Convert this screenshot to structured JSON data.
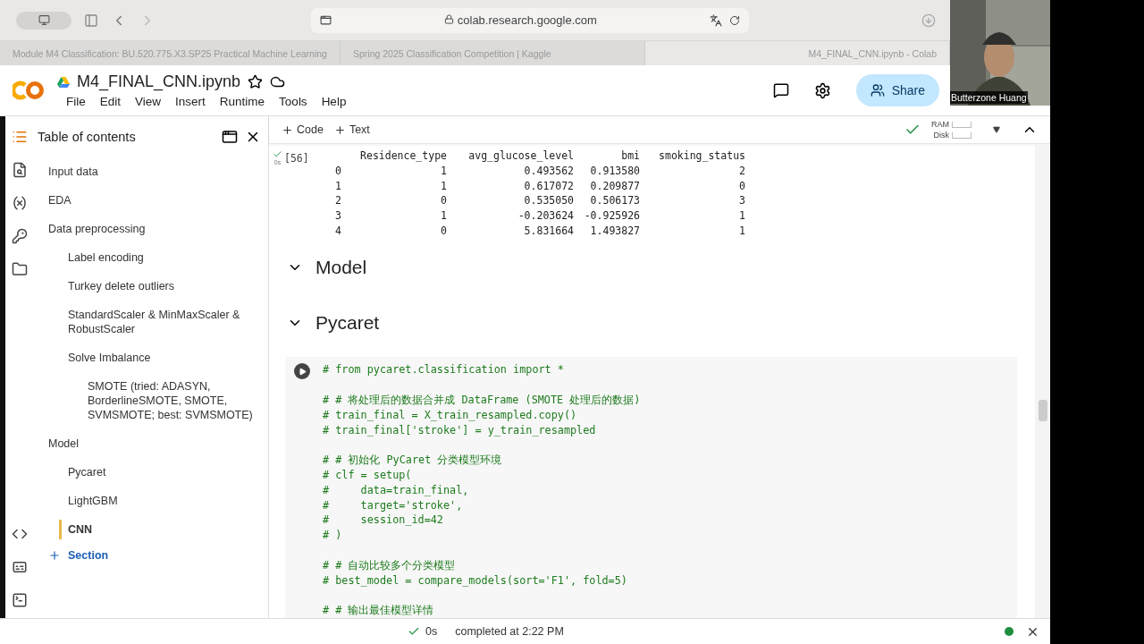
{
  "browser": {
    "url": "colab.research.google.com",
    "tabs": [
      {
        "title": "Module M4 Classification: BU.520.775.X3.SP25 Practical Machine Learning",
        "selected": false
      },
      {
        "title": "Spring 2025 Classification Competition | Kaggle",
        "selected": false
      },
      {
        "title": "M4_FINAL_CNN.ipynb - Colab",
        "selected": true
      }
    ]
  },
  "notebook": {
    "title": "M4_FINAL_CNN.ipynb",
    "menu": [
      "File",
      "Edit",
      "View",
      "Insert",
      "Runtime",
      "Tools",
      "Help"
    ],
    "share": "Share"
  },
  "toc": {
    "title": "Table of contents",
    "items": [
      {
        "label": "Input data",
        "selected": false
      },
      {
        "label": "EDA",
        "selected": false
      },
      {
        "label": "Data preprocessing",
        "selected": false,
        "children": [
          {
            "label": "Label encoding",
            "selected": false
          },
          {
            "label": "Turkey delete outliers",
            "selected": false
          },
          {
            "label": "StandardScaler & MinMaxScaler & RobustScaler",
            "selected": false
          },
          {
            "label": "Solve Imbalance",
            "selected": false,
            "children": [
              {
                "label": "SMOTE (tried: ADASYN, BorderlineSMOTE, SMOTE, SVMSMOTE; best: SVMSMOTE)",
                "selected": false
              }
            ]
          }
        ]
      },
      {
        "label": "Model",
        "selected": false,
        "children": [
          {
            "label": "Pycaret",
            "selected": false
          },
          {
            "label": "LightGBM",
            "selected": false
          },
          {
            "label": "CNN",
            "selected": true
          }
        ]
      }
    ],
    "add_section": "Section"
  },
  "cell_toolbar": {
    "add_code": "Code",
    "add_text": "Text",
    "ram": "RAM",
    "disk": "Disk"
  },
  "output_cell": {
    "count": "[56]",
    "time": "0s",
    "columns": [
      "Residence_type",
      "avg_glucose_level",
      "bmi",
      "smoking_status"
    ],
    "rows": [
      {
        "index": "0",
        "cells": [
          "1",
          "0.493562",
          "0.913580",
          "2"
        ]
      },
      {
        "index": "1",
        "cells": [
          "1",
          "0.617072",
          "0.209877",
          "0"
        ]
      },
      {
        "index": "2",
        "cells": [
          "0",
          "0.535050",
          "0.506173",
          "3"
        ]
      },
      {
        "index": "3",
        "cells": [
          "1",
          "-0.203624",
          "-0.925926",
          "1"
        ]
      },
      {
        "index": "4",
        "cells": [
          "0",
          "5.831664",
          "1.493827",
          "1"
        ]
      }
    ]
  },
  "sections": [
    {
      "title": "Model",
      "expanded": true
    },
    {
      "title": "Pycaret",
      "expanded": true
    }
  ],
  "code_cell": {
    "blocks": [
      [
        "# from pycaret.classification import *"
      ],
      [
        "# # 将处理后的数据合并成 DataFrame (SMOTE 处理后的数据)",
        "# train_final = X_train_resampled.copy()",
        "# train_final['stroke'] = y_train_resampled"
      ],
      [
        "# # 初始化 PyCaret 分类模型环境",
        "# clf = setup(",
        "#     data=train_final,",
        "#     target='stroke',",
        "#     session_id=42",
        "# )"
      ],
      [
        "# # 自动比较多个分类模型",
        "# best_model = compare_models(sort='F1', fold=5)"
      ],
      [
        "# # 输出最佳模型详情"
      ]
    ]
  },
  "status_bar": {
    "time": "0s",
    "message": "completed at 2:22 PM",
    "connected": true
  },
  "video": {
    "name": "Butterzone Huang"
  }
}
